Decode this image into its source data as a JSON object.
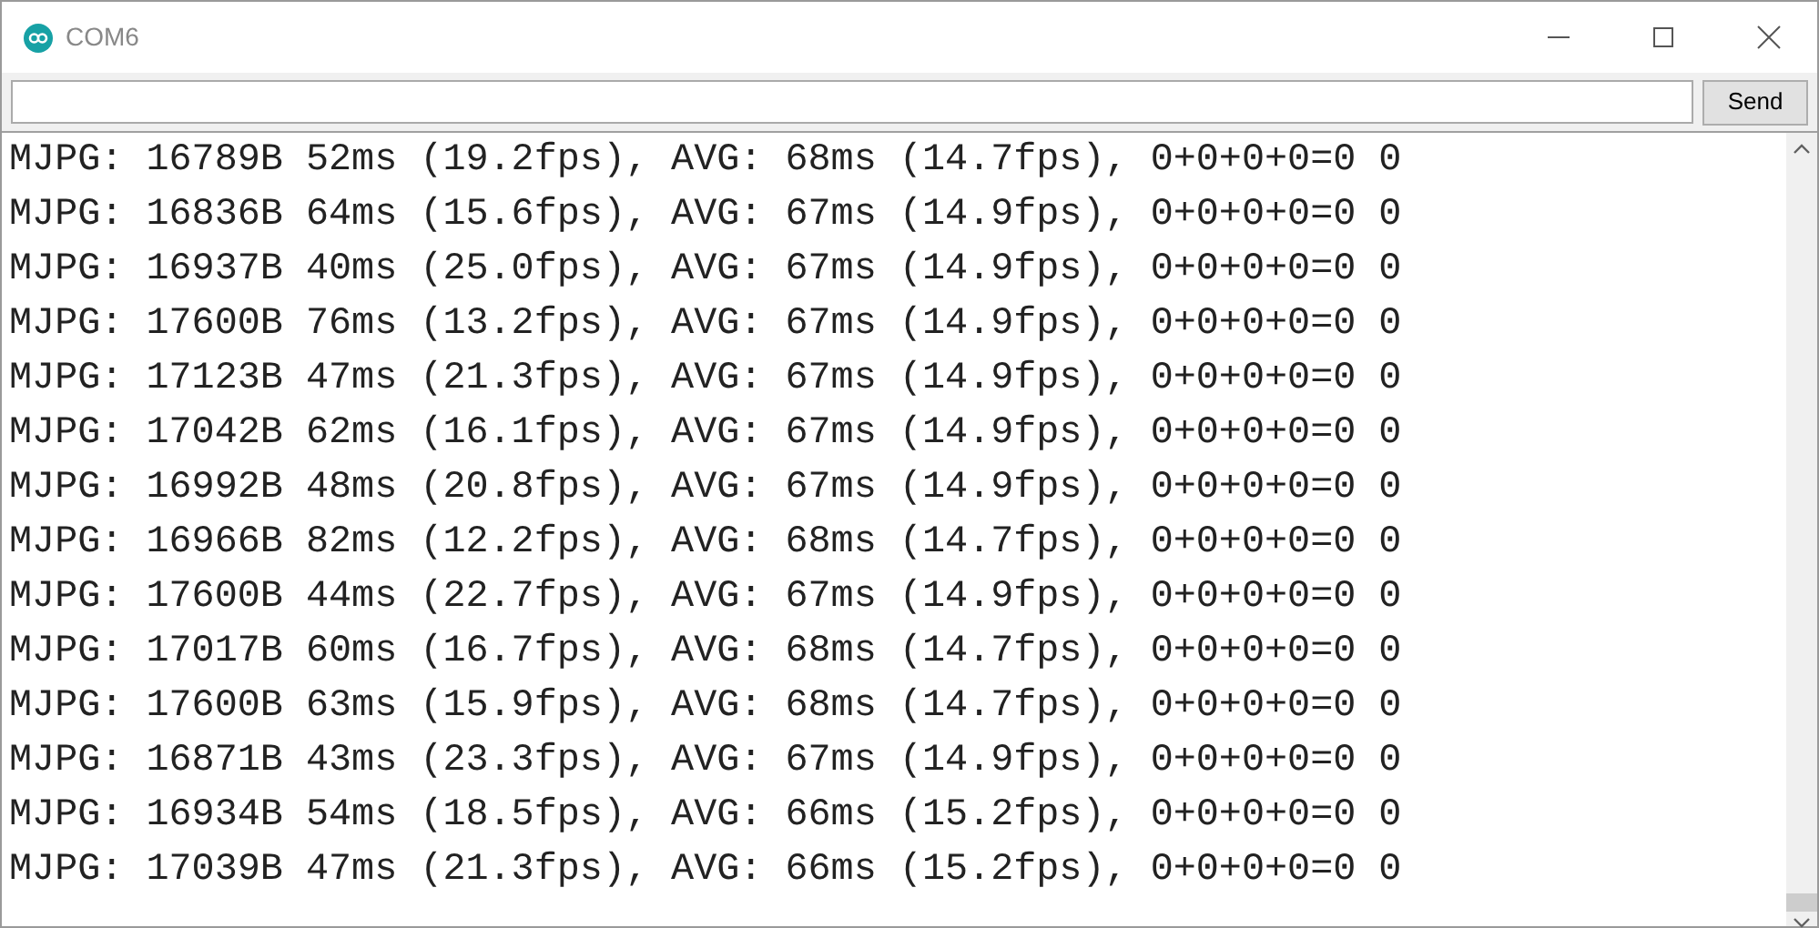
{
  "window": {
    "title": "COM6"
  },
  "send_button": "Send",
  "output_lines": [
    "MJPG: 16789B 52ms (19.2fps), AVG: 68ms (14.7fps), 0+0+0+0=0 0",
    "MJPG: 16836B 64ms (15.6fps), AVG: 67ms (14.9fps), 0+0+0+0=0 0",
    "MJPG: 16937B 40ms (25.0fps), AVG: 67ms (14.9fps), 0+0+0+0=0 0",
    "MJPG: 17600B 76ms (13.2fps), AVG: 67ms (14.9fps), 0+0+0+0=0 0",
    "MJPG: 17123B 47ms (21.3fps), AVG: 67ms (14.9fps), 0+0+0+0=0 0",
    "MJPG: 17042B 62ms (16.1fps), AVG: 67ms (14.9fps), 0+0+0+0=0 0",
    "MJPG: 16992B 48ms (20.8fps), AVG: 67ms (14.9fps), 0+0+0+0=0 0",
    "MJPG: 16966B 82ms (12.2fps), AVG: 68ms (14.7fps), 0+0+0+0=0 0",
    "MJPG: 17600B 44ms (22.7fps), AVG: 67ms (14.9fps), 0+0+0+0=0 0",
    "MJPG: 17017B 60ms (16.7fps), AVG: 68ms (14.7fps), 0+0+0+0=0 0",
    "MJPG: 17600B 63ms (15.9fps), AVG: 68ms (14.7fps), 0+0+0+0=0 0",
    "MJPG: 16871B 43ms (23.3fps), AVG: 67ms (14.9fps), 0+0+0+0=0 0",
    "MJPG: 16934B 54ms (18.5fps), AVG: 66ms (15.2fps), 0+0+0+0=0 0",
    "MJPG: 17039B 47ms (21.3fps), AVG: 66ms (15.2fps), 0+0+0+0=0 0"
  ]
}
